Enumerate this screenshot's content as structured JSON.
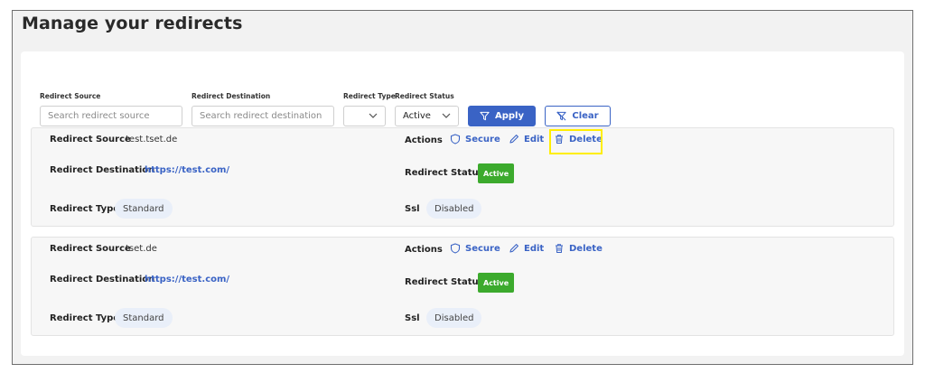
{
  "page": {
    "title": "Manage your redirects"
  },
  "filters": {
    "source_label": "Redirect Source",
    "source_placeholder": "Search redirect source",
    "destination_label": "Redirect Destination",
    "destination_placeholder": "Search redirect destination",
    "type_label": "Redirect Type",
    "type_value": "",
    "status_label": "Redirect Status",
    "status_value": "Active",
    "apply_label": "Apply",
    "clear_label": "Clear"
  },
  "labels": {
    "source": "Redirect Source",
    "destination": "Redirect Destination",
    "type": "Redirect Type",
    "actions": "Actions",
    "status": "Redirect Status",
    "ssl": "Ssl",
    "secure": "Secure",
    "edit": "Edit",
    "delete": "Delete"
  },
  "redirects": [
    {
      "source": "test.tset.de",
      "destination": "https://test.com/",
      "type": "Standard",
      "status": "Active",
      "ssl": "Disabled"
    },
    {
      "source": "tset.de",
      "destination": "https://test.com/",
      "type": "Standard",
      "status": "Active",
      "ssl": "Disabled"
    }
  ],
  "colors": {
    "accent": "#3a63c5",
    "active_badge": "#3caa2d",
    "highlight": "#ffee00"
  },
  "icons": {
    "filter": "funnel-icon",
    "clear": "funnel-clear-icon",
    "secure": "shield-icon",
    "edit": "pencil-icon",
    "delete": "trash-icon",
    "dropdown": "chevron-down-icon"
  }
}
